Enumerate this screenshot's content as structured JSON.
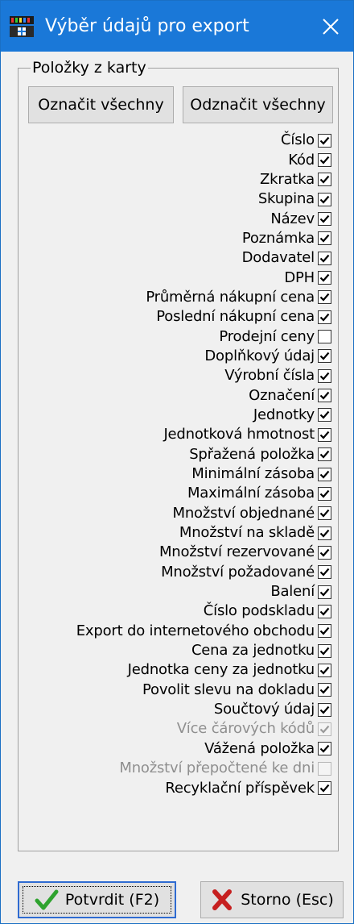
{
  "window": {
    "title": "Výběr údajů pro export",
    "app_icon": "app-icon",
    "close_icon": "close-icon"
  },
  "group": {
    "legend": "Položky z karty",
    "select_all_label": "Označit všechny",
    "deselect_all_label": "Odznačit všechny"
  },
  "items": [
    {
      "label": "Číslo",
      "checked": true,
      "enabled": true
    },
    {
      "label": "Kód",
      "checked": true,
      "enabled": true
    },
    {
      "label": "Zkratka",
      "checked": true,
      "enabled": true
    },
    {
      "label": "Skupina",
      "checked": true,
      "enabled": true
    },
    {
      "label": "Název",
      "checked": true,
      "enabled": true
    },
    {
      "label": "Poznámka",
      "checked": true,
      "enabled": true
    },
    {
      "label": "Dodavatel",
      "checked": true,
      "enabled": true
    },
    {
      "label": "DPH",
      "checked": true,
      "enabled": true
    },
    {
      "label": "Průměrná nákupní cena",
      "checked": true,
      "enabled": true
    },
    {
      "label": "Poslední nákupní cena",
      "checked": true,
      "enabled": true
    },
    {
      "label": "Prodejní ceny",
      "checked": false,
      "enabled": true
    },
    {
      "label": "Doplňkový údaj",
      "checked": true,
      "enabled": true
    },
    {
      "label": "Výrobní čísla",
      "checked": true,
      "enabled": true
    },
    {
      "label": "Označení",
      "checked": true,
      "enabled": true
    },
    {
      "label": "Jednotky",
      "checked": true,
      "enabled": true
    },
    {
      "label": "Jednotková hmotnost",
      "checked": true,
      "enabled": true
    },
    {
      "label": "Spřažená položka",
      "checked": true,
      "enabled": true
    },
    {
      "label": "Minimální zásoba",
      "checked": true,
      "enabled": true
    },
    {
      "label": "Maximální zásoba",
      "checked": true,
      "enabled": true
    },
    {
      "label": "Množství objednané",
      "checked": true,
      "enabled": true
    },
    {
      "label": "Množství na skladě",
      "checked": true,
      "enabled": true
    },
    {
      "label": "Množství rezervované",
      "checked": true,
      "enabled": true
    },
    {
      "label": "Množství požadované",
      "checked": true,
      "enabled": true
    },
    {
      "label": "Balení",
      "checked": true,
      "enabled": true
    },
    {
      "label": "Číslo podskladu",
      "checked": true,
      "enabled": true
    },
    {
      "label": "Export do internetového obchodu",
      "checked": true,
      "enabled": true
    },
    {
      "label": "Cena za jednotku",
      "checked": true,
      "enabled": true
    },
    {
      "label": "Jednotka ceny za jednotku",
      "checked": true,
      "enabled": true
    },
    {
      "label": "Povolit slevu na dokladu",
      "checked": true,
      "enabled": true
    },
    {
      "label": "Součtový údaj",
      "checked": true,
      "enabled": true
    },
    {
      "label": "Více čárových kódů",
      "checked": true,
      "enabled": false
    },
    {
      "label": "Vážená položka",
      "checked": true,
      "enabled": true
    },
    {
      "label": "Množství přepočtené ke dni",
      "checked": false,
      "enabled": false
    },
    {
      "label": "Recyklační příspěvek",
      "checked": true,
      "enabled": true
    }
  ],
  "buttons": {
    "confirm_label": "Potvrdit (F2)",
    "confirm_icon": "checkmark-icon",
    "cancel_label": "Storno (Esc)",
    "cancel_icon": "cross-icon"
  },
  "colors": {
    "titlebar": "#1a78d8",
    "confirm_check": "#2fa32f",
    "cancel_cross": "#c62020"
  }
}
